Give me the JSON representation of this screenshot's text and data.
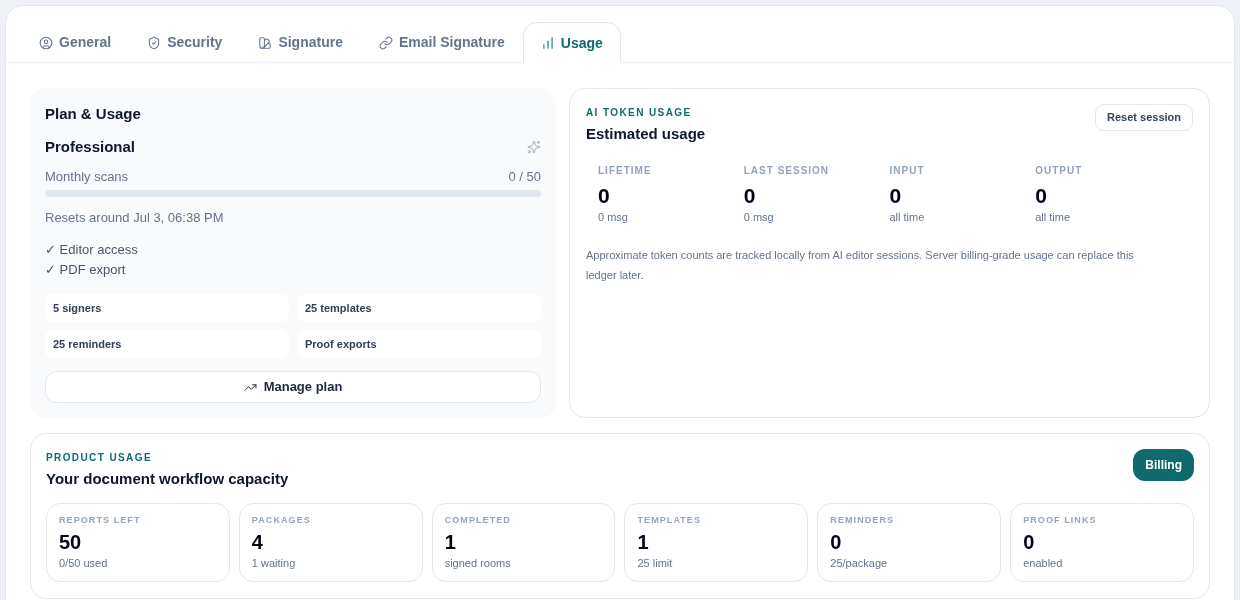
{
  "tabs": [
    {
      "label": "General",
      "selected": false
    },
    {
      "label": "Security",
      "selected": false
    },
    {
      "label": "Signature",
      "selected": false
    },
    {
      "label": "Email Signature",
      "selected": false
    },
    {
      "label": "Usage",
      "selected": true
    }
  ],
  "plan_card": {
    "title": "Plan & Usage",
    "plan_name": "Professional",
    "meter": {
      "label": "Monthly scans",
      "reading": "0 / 50",
      "level": 0
    },
    "reset_note": "Resets around Jul 3, 06:38 PM",
    "features": [
      "✓ Editor access",
      "✓ PDF export"
    ],
    "limits": [
      "5 signers",
      "25 templates",
      "25 reminders",
      "Proof exports"
    ],
    "button": "Manage plan"
  },
  "ai_token_usage": {
    "eyebrow": "AI TOKEN USAGE",
    "title": "Estimated usage",
    "button": "Reset session",
    "stats": [
      {
        "label": "LIFETIME",
        "value": "0",
        "note": "0 msg"
      },
      {
        "label": "LAST SESSION",
        "value": "0",
        "note": "0 msg"
      },
      {
        "label": "INPUT",
        "value": "0",
        "note": "all time"
      },
      {
        "label": "OUTPUT",
        "value": "0",
        "note": "all time"
      }
    ],
    "footnote": "Approximate token counts are tracked locally from AI editor sessions. Server billing-grade usage can replace this ledger later."
  },
  "product_usage": {
    "eyebrow": "PRODUCT USAGE",
    "title": "Your document workflow capacity",
    "button": "Billing",
    "stats": [
      {
        "label": "REPORTS LEFT",
        "value": "50",
        "note": "0/50 used"
      },
      {
        "label": "PACKAGES",
        "value": "4",
        "note": "1 waiting"
      },
      {
        "label": "COMPLETED",
        "value": "1",
        "note": "signed rooms"
      },
      {
        "label": "TEMPLATES",
        "value": "1",
        "note": "25 limit"
      },
      {
        "label": "REMINDERS",
        "value": "0",
        "note": "25/package"
      },
      {
        "label": "PROOF LINKS",
        "value": "0",
        "note": "enabled"
      }
    ]
  }
}
